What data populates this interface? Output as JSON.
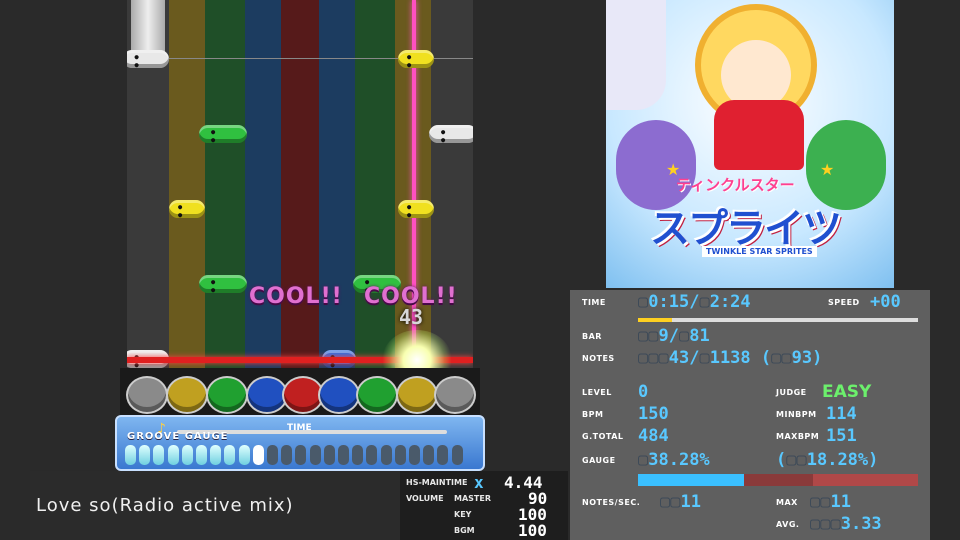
{
  "judge_texts": [
    "COOL!!",
    "COOL!!"
  ],
  "combo": "43",
  "gauge": {
    "label": "GROOVE GAUGE",
    "time_label": "TIME",
    "fill_fraction": 0.38,
    "segments_total": 24
  },
  "song_title": "Love so(Radio active mix)",
  "volume": {
    "hs_label": "HS-MAINTIME",
    "hs_x": "x",
    "hs_value": "4.44",
    "volume_label": "VOLUME",
    "master_label": "MASTER",
    "master_value": "90",
    "key_label": "KEY",
    "key_value": "100",
    "bgm_label": "BGM",
    "bgm_value": "100"
  },
  "stats": {
    "time_label": "TIME",
    "time_current": "0:15",
    "time_total": "2:24",
    "speed_label": "SPEED",
    "speed_value": "+00",
    "progress_fraction": 0.12,
    "bar_label": "BAR",
    "bar_current": "9",
    "bar_total": "81",
    "notes_label": "NOTES",
    "notes_current": "43",
    "notes_total": "1138",
    "notes_paren": "93",
    "level_label": "LEVEL",
    "level_value": "0",
    "judge_label": "JUDGE",
    "judge_value": "EASY",
    "bpm_label": "BPM",
    "bpm_value": "150",
    "minbpm_label": "MINBPM",
    "minbpm_value": "114",
    "gtotal_label": "G.TOTAL",
    "gtotal_value": "484",
    "maxbpm_label": "MAXBPM",
    "maxbpm_value": "151",
    "gauge_label": "GAUGE",
    "gauge_value": "38.28%",
    "gauge_paren": "18.28%",
    "gauge_fill_fraction": 0.38,
    "nps_label": "NOTES/SEC.",
    "nps_value": "11",
    "max_label": "MAX",
    "max_value": "11",
    "avg_label": "AVG.",
    "avg_value": "3.33"
  },
  "banner": {
    "title_jp": "ティンクルスター",
    "title_big": "スプライツ",
    "subtitle": "TWINKLE STAR SPRITES"
  },
  "colors": {
    "lane_white": "#555",
    "lane_yellow": "#7a6a20",
    "lane_green": "#1f5a2a",
    "lane_blue": "#1c3f66",
    "lane_red": "#5a1a1a",
    "judge_pink": "#e070d0",
    "stat_blue": "#59c8ff"
  }
}
